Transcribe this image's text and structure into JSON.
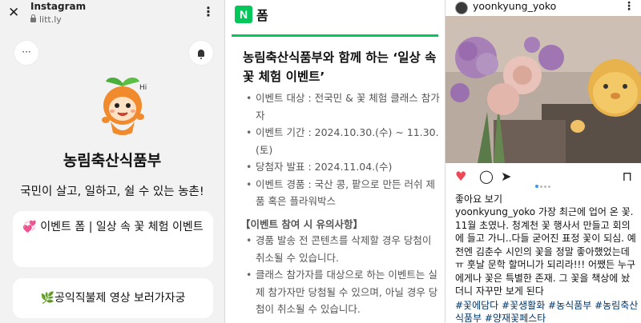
{
  "instagram_browser": {
    "app_title": "Instagram",
    "url": "litt.ly",
    "close_icon": "close-icon",
    "more_icon": "kebab-icon"
  },
  "linktree": {
    "more_button": "···",
    "profile_name": "농림축산식품부",
    "profile_description": "국민이 살고, 일하고, 쉴 수 있는 농촌!",
    "links": [
      {
        "label": "💞 이벤트 폼 | 일상 속 꽃 체험 이벤트"
      },
      {
        "label": "🌿공익직불제 영상 보러가자궁"
      }
    ]
  },
  "naver_form": {
    "logo_letter": "N",
    "header_title": "폼",
    "accent_color": "#03c75a",
    "form_title": "농림축산식품부와 함께 하는 ‘일상 속 꽃 체험 이벤트’",
    "info_items": [
      "이벤트 대상 : 전국민 & 꽃 체험 클래스 참가자",
      "이벤트 기간 : 2024.10.30.(수) ~ 11.30.(토)",
      "당첨자 발표 : 2024.11.04.(수)",
      "이벤트 경품 : 국산 콩, 팥으로 만든 러쉬 제품 혹은 플라워박스"
    ],
    "notice_heading": "【이벤트 참여 시 유의사항】",
    "notice_items": [
      "경품 발송 전 콘텐츠를 삭제할 경우 당첨이 취소될 수 있습니다.",
      "클래스 참가자를 대상으로 하는 이벤트는 실제 참가자만 당첨될 수 있으며, 아닐 경우 당첨이 취소될 수 있습니다."
    ]
  },
  "instagram_post": {
    "username": "yoonkyung_yoko",
    "likes_text": "좋아요 보기",
    "caption_user": "yoonkyung_yoko",
    "caption_text": "가장 최근에 업어 온 꽃. 11월 초였나. 청계천 꽃 행사서 만들고 회의에 들고 가니..다들 굳어진 표정 꽃이 되심. 예전엔 김춘수 시인의 꽃을 정말 좋아했었는데 ㅠ 훗날 문학 할머니가 되리라!!! 어쨌든 누구에게나 꽃은 특별한 존재. 그 꽃을 책상에 놨더니 자꾸만 보게 된다",
    "hashtags": "#꽃에담다 #꽃생활화 #농식품부 #농림축산식품부 #양재꽃페스타",
    "hashtag_color": "#00376b",
    "like_color": "#ed4956"
  }
}
